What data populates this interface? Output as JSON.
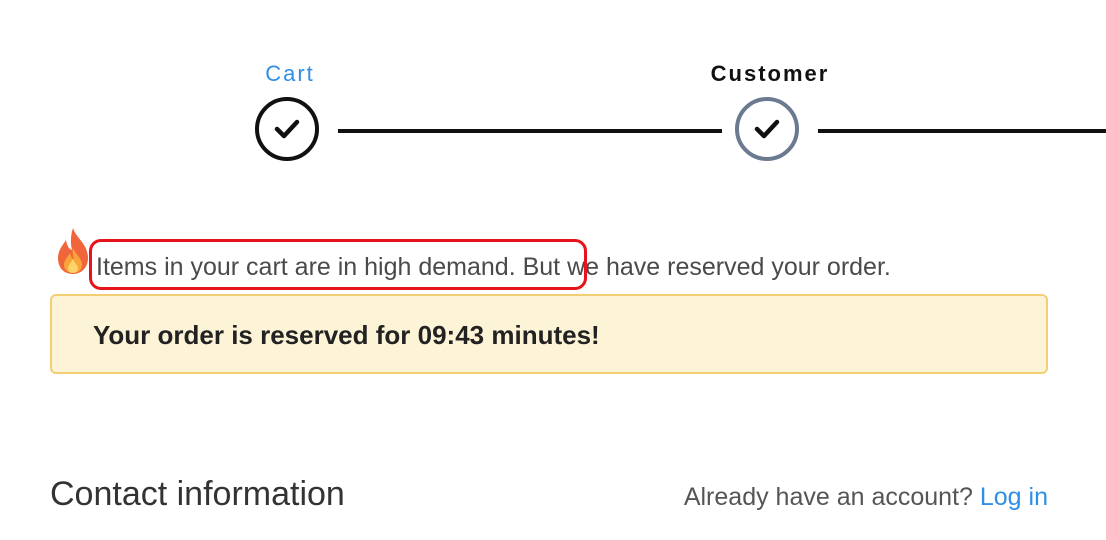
{
  "stepper": {
    "steps": [
      {
        "label": "Cart",
        "state": "complete",
        "color": "#2f8ee5"
      },
      {
        "label": "Customer",
        "state": "current",
        "color": "#111111"
      }
    ],
    "check_icon": "check-icon"
  },
  "notice": {
    "icon": "fire-icon",
    "highlighted_text": "Items in your cart are in high demand.",
    "rest_text": " But we have reserved your order."
  },
  "reservation": {
    "message": "Your order is reserved for 09:43 minutes!",
    "background": "#fdf3d7",
    "border": "#f2cf75"
  },
  "contact": {
    "title": "Contact information",
    "account_prompt": "Already have an account?",
    "login_label": "Log in",
    "link_color": "#2f8ee5"
  }
}
